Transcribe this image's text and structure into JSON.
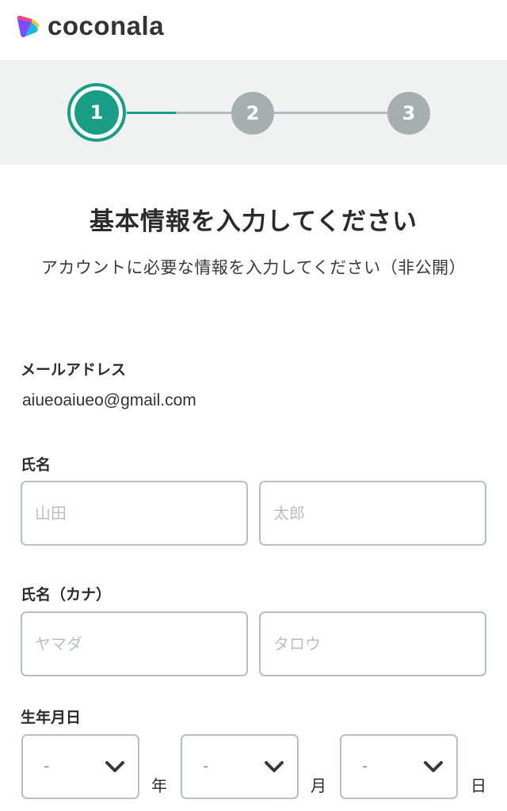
{
  "header": {
    "logo_text": "coconala",
    "logo_colors": [
      "#f5447e",
      "#ffbe2e",
      "#7b4dff",
      "#19b6e6"
    ]
  },
  "stepper": {
    "current_step": 1,
    "steps": [
      "1",
      "2",
      "3"
    ],
    "active_color": "#1a9d86",
    "inactive_color": "#a4afae"
  },
  "main": {
    "title": "基本情報を入力してください",
    "subtitle": "アカウントに必要な情報を入力してください（非公開）"
  },
  "form": {
    "email": {
      "label": "メールアドレス",
      "value": "aiueoaiueo@gmail.com"
    },
    "name": {
      "label": "氏名",
      "last_placeholder": "山田",
      "first_placeholder": "太郎",
      "last_value": "",
      "first_value": ""
    },
    "kana": {
      "label": "氏名（カナ）",
      "last_placeholder": "ヤマダ",
      "first_placeholder": "タロウ",
      "last_value": "",
      "first_value": ""
    },
    "birthday": {
      "label": "生年月日",
      "year_value": "-",
      "month_value": "-",
      "day_value": "-",
      "year_unit": "年",
      "month_unit": "月",
      "day_unit": "日",
      "chevron_icon": "chevron-down-icon"
    }
  }
}
